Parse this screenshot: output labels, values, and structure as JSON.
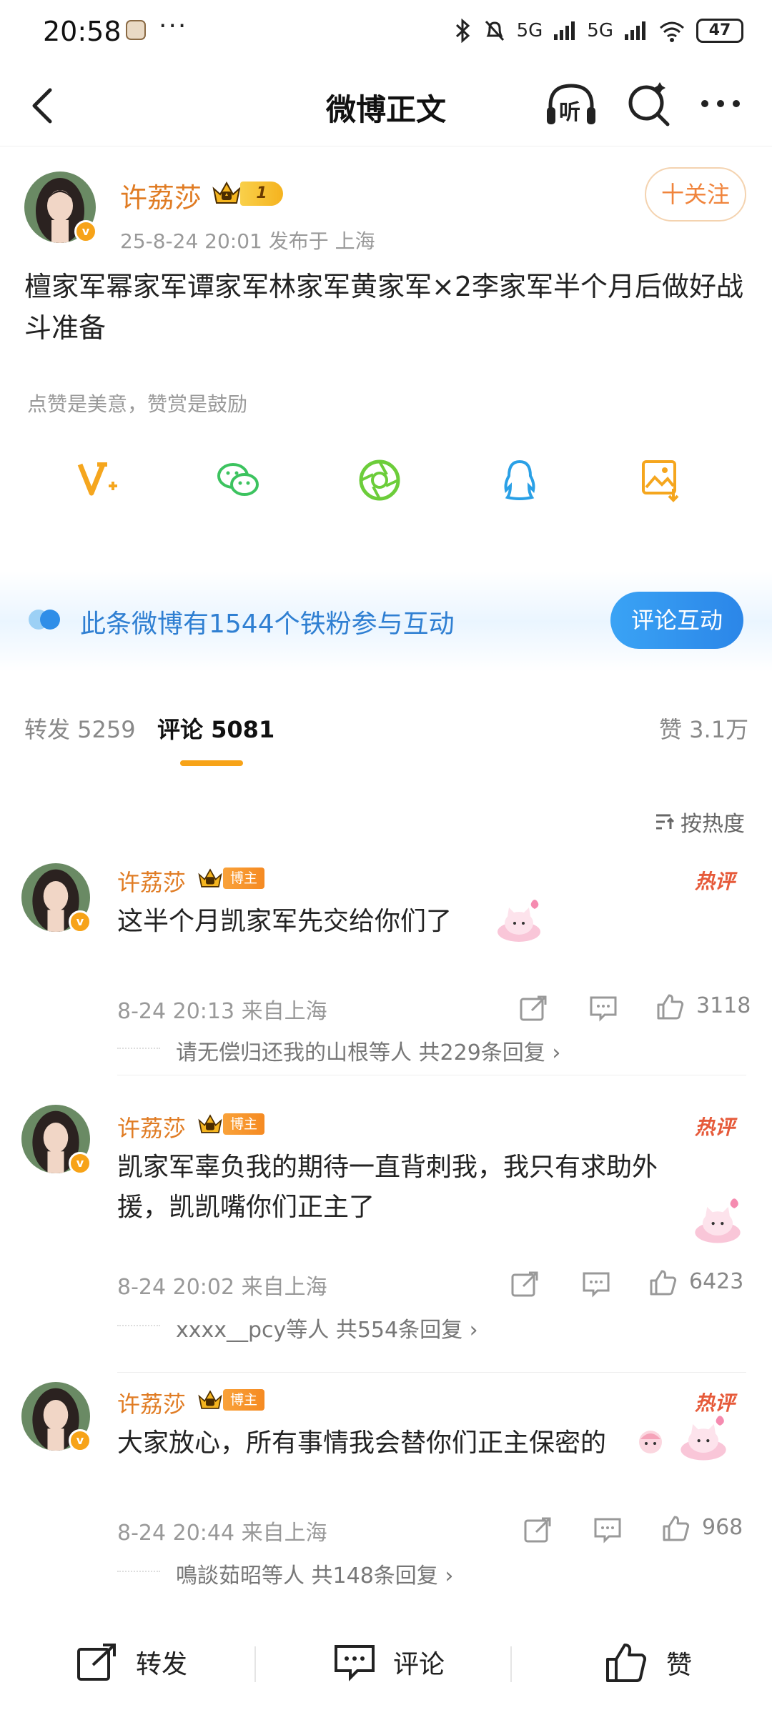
{
  "status_bar": {
    "time": "20:58",
    "dots": "···",
    "battery": "47",
    "signal1": "5G",
    "signal2": "5G"
  },
  "nav": {
    "title": "微博正文",
    "listen_label": "听"
  },
  "post": {
    "author": "许荔莎",
    "level_badge": "1",
    "meta": "25-8-24 20:01   发布于 上海",
    "follow_label": "十关注",
    "text": "檀家军幂家军谭家军林家军黄家军×2李家军半个月后做好战斗准备",
    "reward_text": "点赞是美意，赞赏是鼓励"
  },
  "share_icons": [
    "vplus-icon",
    "wechat-icon",
    "moments-icon",
    "qq-icon",
    "save-image-icon"
  ],
  "fans": {
    "text": "此条微博有1544个铁粉参与互动",
    "button": "评论互动"
  },
  "tabs": {
    "repost": "转发 5259",
    "comment": "评论 5081",
    "like": "赞 3.1万"
  },
  "sort_label": "按热度",
  "comments": [
    {
      "name": "许荔莎",
      "tag": "博主",
      "hot": "热评",
      "text": "这半个月凯家军先交给你们了",
      "meta": "8-24 20:13  来自上海",
      "likes": "3118",
      "reply": "请无偿归还我的山根等人  共229条回复 ›"
    },
    {
      "name": "许荔莎",
      "tag": "博主",
      "hot": "热评",
      "text": "凯家军辜负我的期待一直背刺我，我只有求助外援，凯凯嘴你们正主了",
      "meta": "8-24 20:02  来自上海",
      "likes": "6423",
      "reply": "xxxx__pcy等人  共554条回复 ›"
    },
    {
      "name": "许荔莎",
      "tag": "博主",
      "hot": "热评",
      "text": "大家放心，所有事情我会替你们正主保密的",
      "meta": "8-24 20:44  来自上海",
      "likes": "968",
      "reply": "鳴談茹昭等人  共148条回复 ›"
    }
  ],
  "bottom_bar": {
    "repost": "转发",
    "comment": "评论",
    "like": "赞"
  },
  "colors": {
    "accent_orange": "#f7a318",
    "name_orange": "#e07c24",
    "link_blue": "#2f7fd2",
    "hot_red": "#e65a3a"
  }
}
